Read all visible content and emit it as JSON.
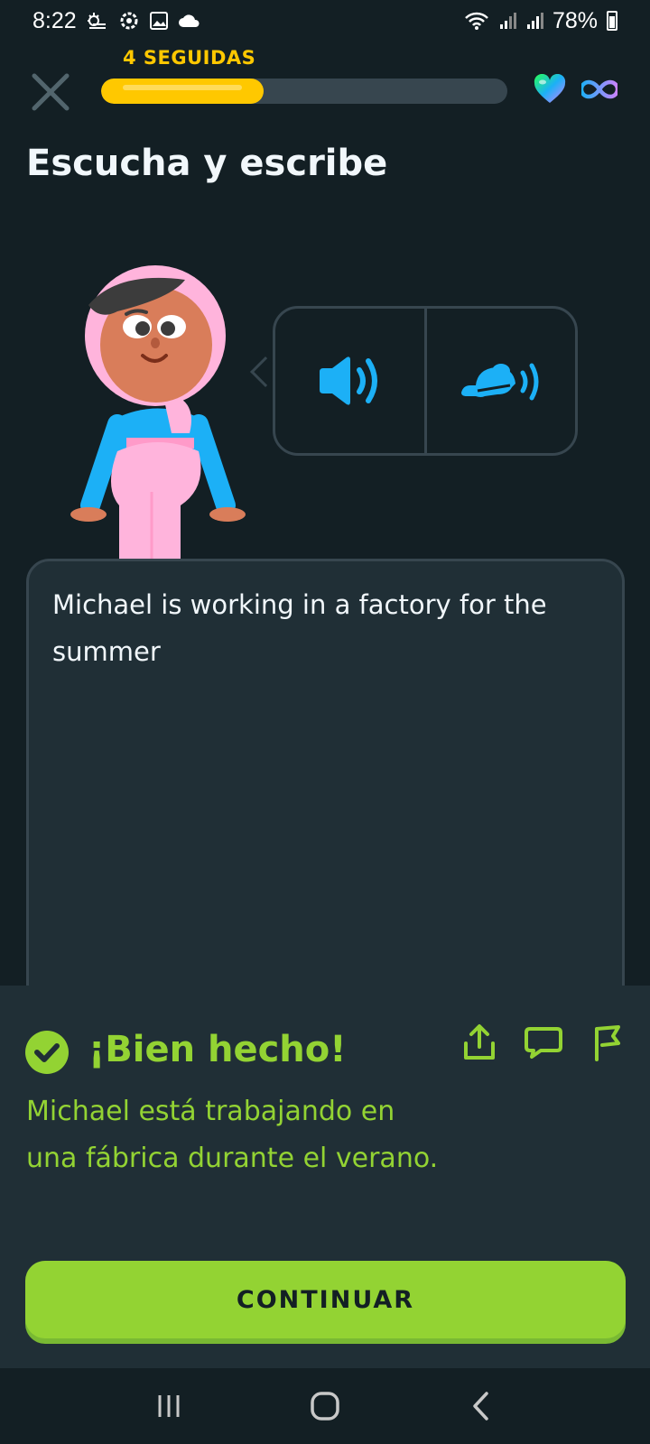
{
  "status_bar": {
    "time": "8:22",
    "battery": "78%"
  },
  "header": {
    "streak_label": "4 SEGUIDAS",
    "progress_fraction": 0.4
  },
  "lesson": {
    "title": "Escucha y escribe"
  },
  "answer": {
    "text": "Michael is working in a factory for the summer"
  },
  "feedback": {
    "title": "¡Bien hecho!",
    "translation": "Michael está trabajando en una fábrica durante el verano.",
    "continue_label": "CONTINUAR"
  },
  "colors": {
    "background": "#131f24",
    "streak": "#ffc800",
    "success": "#93d333",
    "audio": "#1cb0f6"
  },
  "icons": [
    "close-icon",
    "heart-icon",
    "infinity-icon",
    "speaker-icon",
    "turtle-speaker-icon",
    "check-icon",
    "share-icon",
    "comment-icon",
    "flag-icon"
  ]
}
